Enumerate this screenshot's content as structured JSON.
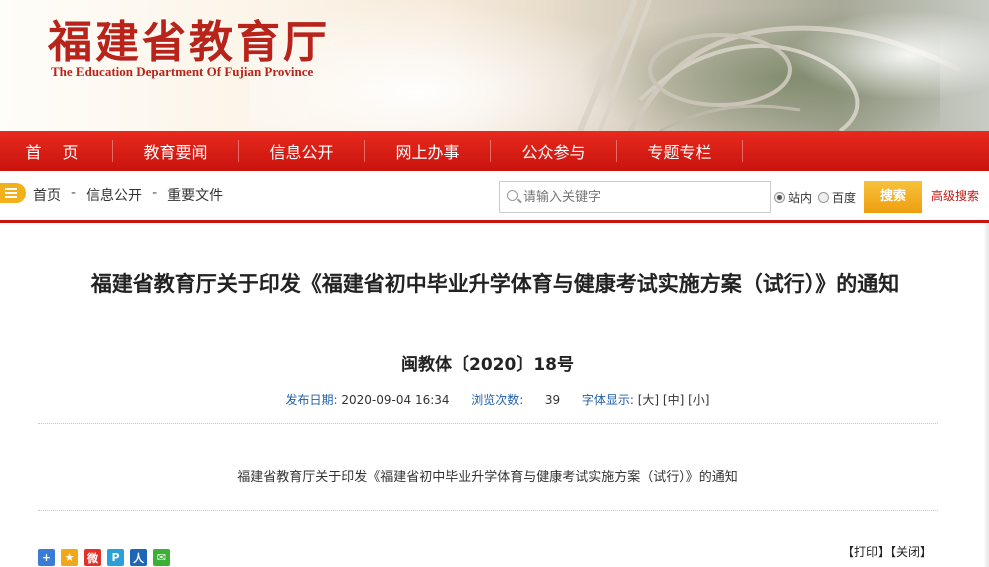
{
  "header": {
    "logo_cn": "福建省教育厅",
    "logo_en": "The Education Department Of Fujian Province"
  },
  "nav": {
    "items": [
      "首 页",
      "教育要闻",
      "信息公开",
      "网上办事",
      "公众参与",
      "专题专栏"
    ]
  },
  "breadcrumb": {
    "items": [
      "首页",
      "信息公开",
      "重要文件"
    ],
    "separator": "-"
  },
  "search": {
    "placeholder": "请输入关键字",
    "scope_site": "站内",
    "scope_baidu": "百度",
    "selected_scope": "站内",
    "button_label": "搜索",
    "advanced_label": "高级搜索"
  },
  "article": {
    "title": "福建省教育厅关于印发《福建省初中毕业升学体育与健康考试实施方案（试行）》的通知",
    "doc_number": "闽教体〔2020〕18号",
    "meta": {
      "publish_label": "发布日期:",
      "publish_date": "2020-09-04 16:34",
      "views_label": "浏览次数:",
      "views": "39",
      "font_label": "字体显示:",
      "font_large": "[大]",
      "font_medium": "[中]",
      "font_small": "[小]"
    },
    "body": "福建省教育厅关于印发《福建省初中毕业升学体育与健康考试实施方案（试行）》的通知",
    "print_label": "【打印】",
    "close_label": "【关闭】"
  },
  "share": {
    "icons": [
      {
        "name": "share-more-icon",
        "glyph": "+",
        "color": "#3a7bd5"
      },
      {
        "name": "qzone-icon",
        "glyph": "★",
        "color": "#f0a81a"
      },
      {
        "name": "weibo-icon",
        "glyph": "微",
        "color": "#e0322b"
      },
      {
        "name": "tencent-weibo-icon",
        "glyph": "P",
        "color": "#2a9fd8"
      },
      {
        "name": "renren-icon",
        "glyph": "人",
        "color": "#1f66b8"
      },
      {
        "name": "wechat-icon",
        "glyph": "✉",
        "color": "#3cb034"
      }
    ]
  },
  "colors": {
    "brand_red": "#c8140e",
    "link_blue": "#1f5fa8",
    "search_orange": "#f0a81a"
  }
}
